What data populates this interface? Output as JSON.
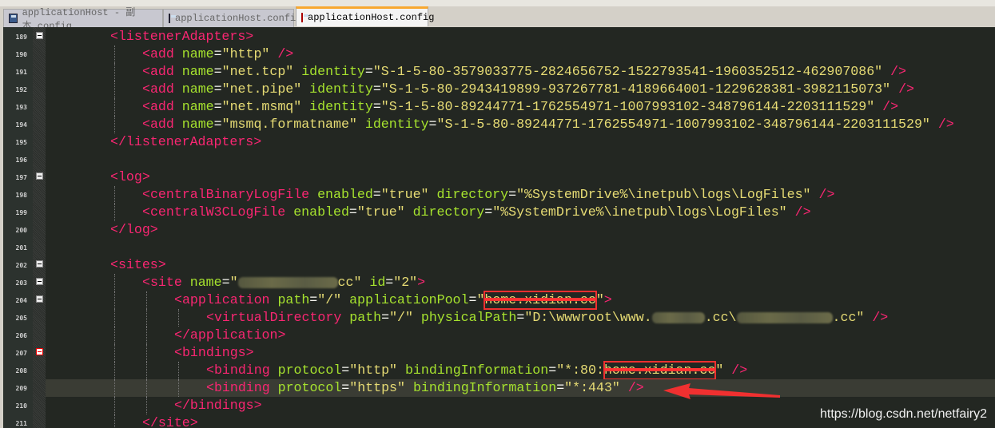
{
  "tabs": [
    {
      "label": "applicationHost - 副本.config",
      "active": false
    },
    {
      "label": "applicationHost.config",
      "active": false
    },
    {
      "label": "applicationHost.config",
      "active": true
    }
  ],
  "current_line": 209,
  "lines": [
    {
      "n": 189,
      "indent": 0,
      "fold": "box",
      "tokens": [
        [
          "t",
          "<listenerAdapters>"
        ]
      ]
    },
    {
      "n": 190,
      "indent": 1,
      "tokens": [
        [
          "t",
          "<add "
        ],
        [
          "a",
          "name"
        ],
        [
          "p",
          "="
        ],
        [
          "v",
          "\"http\""
        ],
        [
          "t",
          " />"
        ]
      ]
    },
    {
      "n": 191,
      "indent": 1,
      "tokens": [
        [
          "t",
          "<add "
        ],
        [
          "a",
          "name"
        ],
        [
          "p",
          "="
        ],
        [
          "v",
          "\"net.tcp\""
        ],
        [
          "a",
          " identity"
        ],
        [
          "p",
          "="
        ],
        [
          "v",
          "\"S-1-5-80-3579033775-2824656752-1522793541-1960352512-462907086\""
        ],
        [
          "t",
          " />"
        ]
      ]
    },
    {
      "n": 192,
      "indent": 1,
      "tokens": [
        [
          "t",
          "<add "
        ],
        [
          "a",
          "name"
        ],
        [
          "p",
          "="
        ],
        [
          "v",
          "\"net.pipe\""
        ],
        [
          "a",
          " identity"
        ],
        [
          "p",
          "="
        ],
        [
          "v",
          "\"S-1-5-80-2943419899-937267781-4189664001-1229628381-3982115073\""
        ],
        [
          "t",
          " />"
        ]
      ]
    },
    {
      "n": 193,
      "indent": 1,
      "tokens": [
        [
          "t",
          "<add "
        ],
        [
          "a",
          "name"
        ],
        [
          "p",
          "="
        ],
        [
          "v",
          "\"net.msmq\""
        ],
        [
          "a",
          " identity"
        ],
        [
          "p",
          "="
        ],
        [
          "v",
          "\"S-1-5-80-89244771-1762554971-1007993102-348796144-2203111529\""
        ],
        [
          "t",
          " />"
        ]
      ]
    },
    {
      "n": 194,
      "indent": 1,
      "tokens": [
        [
          "t",
          "<add "
        ],
        [
          "a",
          "name"
        ],
        [
          "p",
          "="
        ],
        [
          "v",
          "\"msmq.formatname\""
        ],
        [
          "a",
          " identity"
        ],
        [
          "p",
          "="
        ],
        [
          "v",
          "\"S-1-5-80-89244771-1762554971-1007993102-348796144-2203111529\""
        ],
        [
          "t",
          " />"
        ]
      ]
    },
    {
      "n": 195,
      "indent": 0,
      "tokens": [
        [
          "t",
          "</listenerAdapters>"
        ]
      ]
    },
    {
      "n": 196,
      "indent": 0,
      "tokens": []
    },
    {
      "n": 197,
      "indent": 0,
      "fold": "box",
      "tokens": [
        [
          "t",
          "<log>"
        ]
      ]
    },
    {
      "n": 198,
      "indent": 1,
      "tokens": [
        [
          "t",
          "<centralBinaryLogFile "
        ],
        [
          "a",
          "enabled"
        ],
        [
          "p",
          "="
        ],
        [
          "v",
          "\"true\""
        ],
        [
          "a",
          " directory"
        ],
        [
          "p",
          "="
        ],
        [
          "v",
          "\"%SystemDrive%\\inetpub\\logs\\LogFiles\""
        ],
        [
          "t",
          " />"
        ]
      ]
    },
    {
      "n": 199,
      "indent": 1,
      "tokens": [
        [
          "t",
          "<centralW3CLogFile "
        ],
        [
          "a",
          "enabled"
        ],
        [
          "p",
          "="
        ],
        [
          "v",
          "\"true\""
        ],
        [
          "a",
          " directory"
        ],
        [
          "p",
          "="
        ],
        [
          "v",
          "\"%SystemDrive%\\inetpub\\logs\\LogFiles\""
        ],
        [
          "t",
          " />"
        ]
      ]
    },
    {
      "n": 200,
      "indent": 0,
      "tokens": [
        [
          "t",
          "</log>"
        ]
      ]
    },
    {
      "n": 201,
      "indent": 0,
      "tokens": []
    },
    {
      "n": 202,
      "indent": 0,
      "fold": "box",
      "tokens": [
        [
          "t",
          "<sites>"
        ]
      ]
    },
    {
      "n": 203,
      "indent": 1,
      "fold": "box",
      "tokens": [
        [
          "t",
          "<site "
        ],
        [
          "a",
          "name"
        ],
        [
          "p",
          "="
        ],
        [
          "v",
          "\""
        ],
        [
          "blur",
          "s"
        ],
        [
          "v",
          "cc\""
        ],
        [
          "a",
          " id"
        ],
        [
          "p",
          "="
        ],
        [
          "v",
          "\"2\""
        ],
        [
          "t",
          ">"
        ]
      ]
    },
    {
      "n": 204,
      "indent": 2,
      "fold": "box",
      "tokens": [
        [
          "t",
          "<application "
        ],
        [
          "a",
          "path"
        ],
        [
          "p",
          "="
        ],
        [
          "v",
          "\"/\""
        ],
        [
          "a",
          " applicationPool"
        ],
        [
          "p",
          "="
        ],
        [
          "v",
          "\""
        ],
        [
          "box",
          "home.xidian.cc"
        ],
        [
          "v",
          "\""
        ],
        [
          "t",
          ">"
        ]
      ]
    },
    {
      "n": 205,
      "indent": 3,
      "tokens": [
        [
          "t",
          "<virtualDirectory "
        ],
        [
          "a",
          "path"
        ],
        [
          "p",
          "="
        ],
        [
          "v",
          "\"/\""
        ],
        [
          "a",
          " physicalPath"
        ],
        [
          "p",
          "="
        ],
        [
          "v",
          "\"D:\\wwwroot\\www."
        ],
        [
          "blur",
          "m"
        ],
        [
          "v",
          ".cc\\"
        ],
        [
          "blur",
          "l"
        ],
        [
          "v",
          ".cc\""
        ],
        [
          "t",
          " />"
        ]
      ]
    },
    {
      "n": 206,
      "indent": 2,
      "tokens": [
        [
          "t",
          "</application>"
        ]
      ]
    },
    {
      "n": 207,
      "indent": 2,
      "fold": "red",
      "tokens": [
        [
          "t",
          "<bindings>"
        ]
      ]
    },
    {
      "n": 208,
      "indent": 3,
      "tokens": [
        [
          "t",
          "<binding "
        ],
        [
          "a",
          "protocol"
        ],
        [
          "p",
          "="
        ],
        [
          "v",
          "\"http\""
        ],
        [
          "a",
          " bindingInformation"
        ],
        [
          "p",
          "="
        ],
        [
          "v",
          "\"*:80:"
        ],
        [
          "box",
          "home.xidian.cc"
        ],
        [
          "v",
          "\""
        ],
        [
          "t",
          " />"
        ]
      ]
    },
    {
      "n": 209,
      "indent": 3,
      "tokens": [
        [
          "t",
          "<binding "
        ],
        [
          "a",
          "protocol"
        ],
        [
          "p",
          "="
        ],
        [
          "v",
          "\"https\""
        ],
        [
          "a",
          " bindingInformation"
        ],
        [
          "p",
          "="
        ],
        [
          "v",
          "\"*:443\""
        ],
        [
          "t",
          " />"
        ]
      ]
    },
    {
      "n": 210,
      "indent": 2,
      "tokens": [
        [
          "t",
          "</bindings>"
        ]
      ]
    },
    {
      "n": 211,
      "indent": 1,
      "tokens": [
        [
          "t",
          "</site>"
        ]
      ]
    }
  ],
  "annotation_color": "#f03030",
  "watermark": "https://blog.csdn.net/netfairy2"
}
